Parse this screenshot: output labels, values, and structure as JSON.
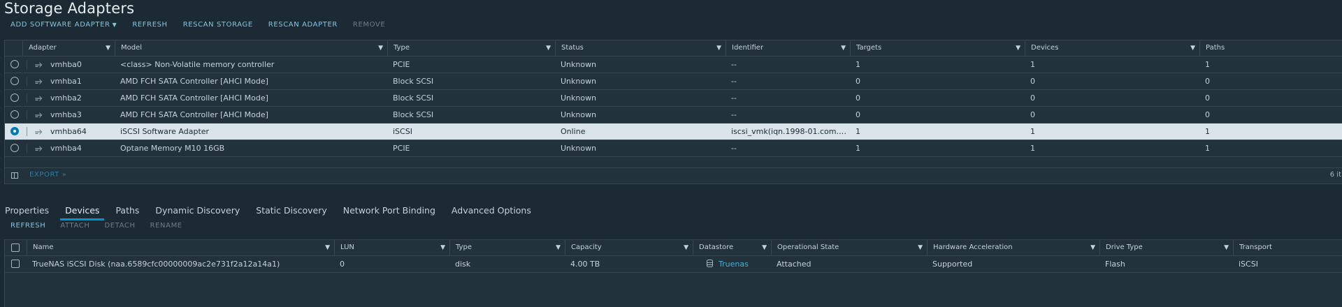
{
  "page_title": "Storage Adapters",
  "toolbar": {
    "add_software_adapter": "ADD SOFTWARE ADAPTER",
    "refresh": "REFRESH",
    "rescan_storage": "RESCAN STORAGE",
    "rescan_adapter": "RESCAN ADAPTER",
    "remove": "REMOVE"
  },
  "adapters": {
    "columns": [
      "Adapter",
      "Model",
      "Type",
      "Status",
      "Identifier",
      "Targets",
      "Devices",
      "Paths"
    ],
    "rows": [
      {
        "adapter": "vmhba0",
        "model": "<class> Non-Volatile memory controller",
        "type": "PCIE",
        "status": "Unknown",
        "identifier": "--",
        "targets": "1",
        "devices": "1",
        "paths": "1"
      },
      {
        "adapter": "vmhba1",
        "model": "AMD FCH SATA Controller [AHCI Mode]",
        "type": "Block SCSI",
        "status": "Unknown",
        "identifier": "--",
        "targets": "0",
        "devices": "0",
        "paths": "0"
      },
      {
        "adapter": "vmhba2",
        "model": "AMD FCH SATA Controller [AHCI Mode]",
        "type": "Block SCSI",
        "status": "Unknown",
        "identifier": "--",
        "targets": "0",
        "devices": "0",
        "paths": "0"
      },
      {
        "adapter": "vmhba3",
        "model": "AMD FCH SATA Controller [AHCI Mode]",
        "type": "Block SCSI",
        "status": "Unknown",
        "identifier": "--",
        "targets": "0",
        "devices": "0",
        "paths": "0"
      },
      {
        "adapter": "vmhba64",
        "model": "iSCSI Software Adapter",
        "type": "iSCSI",
        "status": "Online",
        "identifier": "iscsi_vmk(iqn.1998-01.com.v...",
        "targets": "1",
        "devices": "1",
        "paths": "1",
        "selected": true
      },
      {
        "adapter": "vmhba4",
        "model": "Optane Memory M10 16GB",
        "type": "PCIE",
        "status": "Unknown",
        "identifier": "--",
        "targets": "1",
        "devices": "1",
        "paths": "1"
      }
    ],
    "export_label": "EXPORT",
    "count_label": "6 it"
  },
  "tabs": [
    "Properties",
    "Devices",
    "Paths",
    "Dynamic Discovery",
    "Static Discovery",
    "Network Port Binding",
    "Advanced Options"
  ],
  "active_tab": "Devices",
  "device_actions": {
    "refresh": "REFRESH",
    "attach": "ATTACH",
    "detach": "DETACH",
    "rename": "RENAME"
  },
  "devices": {
    "columns": [
      "Name",
      "LUN",
      "Type",
      "Capacity",
      "Datastore",
      "Operational State",
      "Hardware Acceleration",
      "Drive Type",
      "Transport"
    ],
    "rows": [
      {
        "name": "TrueNAS iSCSI Disk (naa.6589cfc00000009ac2e731f2a12a14a1)",
        "lun": "0",
        "type": "disk",
        "capacity": "4.00 TB",
        "datastore": "Truenas",
        "operational_state": "Attached",
        "hardware_acceleration": "Supported",
        "drive_type": "Flash",
        "transport": "iSCSI"
      }
    ]
  },
  "icons": {
    "filter": "filter-icon",
    "adapter": "adapter-icon",
    "columns": "column-toggle-icon",
    "datastore": "datastore-icon"
  },
  "colors": {
    "background": "#1b2a33",
    "accent": "#0095d3",
    "link": "#7fc7e6",
    "selected_row": "#d9e3e9"
  }
}
